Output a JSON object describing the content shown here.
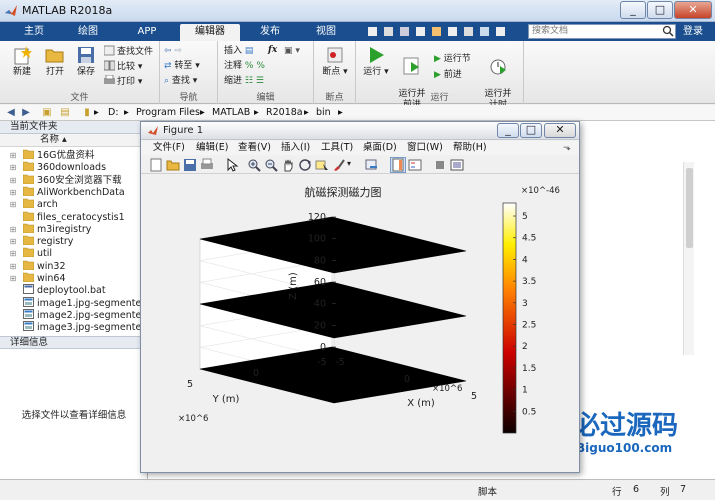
{
  "window": {
    "title": "MATLAB R2018a",
    "minimize": "_",
    "maximize": "□",
    "close": "✕"
  },
  "tabs": [
    {
      "label": "主页",
      "active": false
    },
    {
      "label": "绘图",
      "active": false
    },
    {
      "label": "APP",
      "active": false
    },
    {
      "label": "编辑器",
      "active": true
    },
    {
      "label": "发布",
      "active": false
    },
    {
      "label": "视图",
      "active": false
    }
  ],
  "search": {
    "placeholder": "搜索文档"
  },
  "login": "登录",
  "toolstrip": {
    "file": {
      "label": "文件",
      "new": "新建",
      "open": "打开",
      "save": "保存",
      "find_files": "查找文件",
      "compare": "比较",
      "print": "打印"
    },
    "navigate": {
      "label": "导航",
      "goto": "转至",
      "find": "查找"
    },
    "edit": {
      "label": "编辑",
      "insert": "插入",
      "comment": "注释",
      "indent": "缩进",
      "fx": "fx"
    },
    "breakpoints": {
      "label": "断点",
      "button": "断点"
    },
    "run": {
      "label": "运行",
      "run": "运行",
      "run_advance": "运行并\n前进",
      "run_section": "运行节",
      "advance": "前进",
      "run_time": "运行并\n计时"
    }
  },
  "address": {
    "segments": [
      "D:",
      "Program Files",
      "MATLAB",
      "R2018a",
      "bin"
    ]
  },
  "current_folder": {
    "title": "当前文件夹",
    "column": "名称",
    "items": [
      {
        "name": "16G优盘资料",
        "type": "folder",
        "expandable": true
      },
      {
        "name": "360downloads",
        "type": "folder",
        "expandable": true
      },
      {
        "name": "360安全浏览器下载",
        "type": "folder",
        "expandable": true
      },
      {
        "name": "AliWorkbenchData",
        "type": "folder",
        "expandable": true
      },
      {
        "name": "arch",
        "type": "folder",
        "expandable": true
      },
      {
        "name": "files_ceratocystis1",
        "type": "folder",
        "expandable": false
      },
      {
        "name": "m3iregistry",
        "type": "folder",
        "expandable": true
      },
      {
        "name": "registry",
        "type": "folder",
        "expandable": true
      },
      {
        "name": "util",
        "type": "folder",
        "expandable": true
      },
      {
        "name": "win32",
        "type": "folder",
        "expandable": true
      },
      {
        "name": "win64",
        "type": "folder",
        "expandable": true
      },
      {
        "name": "deploytool.bat",
        "type": "bat",
        "expandable": false
      },
      {
        "name": "image1.jpg-segmente...",
        "type": "file",
        "expandable": false
      },
      {
        "name": "image2.jpg-segmente...",
        "type": "file",
        "expandable": false
      },
      {
        "name": "image3.jpg-segmente...",
        "type": "file",
        "expandable": false
      }
    ]
  },
  "details": {
    "title": "详细信息",
    "message": "选择文件以查看详细信息"
  },
  "figure": {
    "title": "Figure 1",
    "menus": [
      "文件(F)",
      "编辑(E)",
      "查看(V)",
      "插入(I)",
      "工具(T)",
      "桌面(D)",
      "窗口(W)",
      "帮助(H)"
    ]
  },
  "chart_data": {
    "type": "surface3d",
    "title": "航磁探测磁力图",
    "xlabel": "X (m)",
    "ylabel": "Y (m)",
    "zlabel": "Z (m)",
    "z_ticks": [
      0,
      20,
      40,
      60,
      80,
      100,
      120
    ],
    "x_ticks": [
      -5,
      0,
      5
    ],
    "y_ticks": [
      -5,
      0,
      5
    ],
    "x_multiplier": "×10^6",
    "y_multiplier": "×10^6",
    "slices": [
      {
        "z": 0,
        "fill": "#000000"
      },
      {
        "z": 60,
        "fill": "#000000"
      },
      {
        "z": 120,
        "fill": "#000000"
      }
    ],
    "colorbar": {
      "ticks": [
        0.5,
        1,
        1.5,
        2,
        2.5,
        3,
        3.5,
        4,
        4.5,
        5
      ],
      "range": [
        0,
        5.3
      ],
      "multiplier": "×10^-46",
      "colormap": "hot"
    }
  },
  "watermark": {
    "text": "必过源码",
    "url": "Biguo100.com"
  },
  "status": {
    "mode": "脚本",
    "row_label": "行",
    "row": "6",
    "col_label": "列",
    "col": "7"
  }
}
